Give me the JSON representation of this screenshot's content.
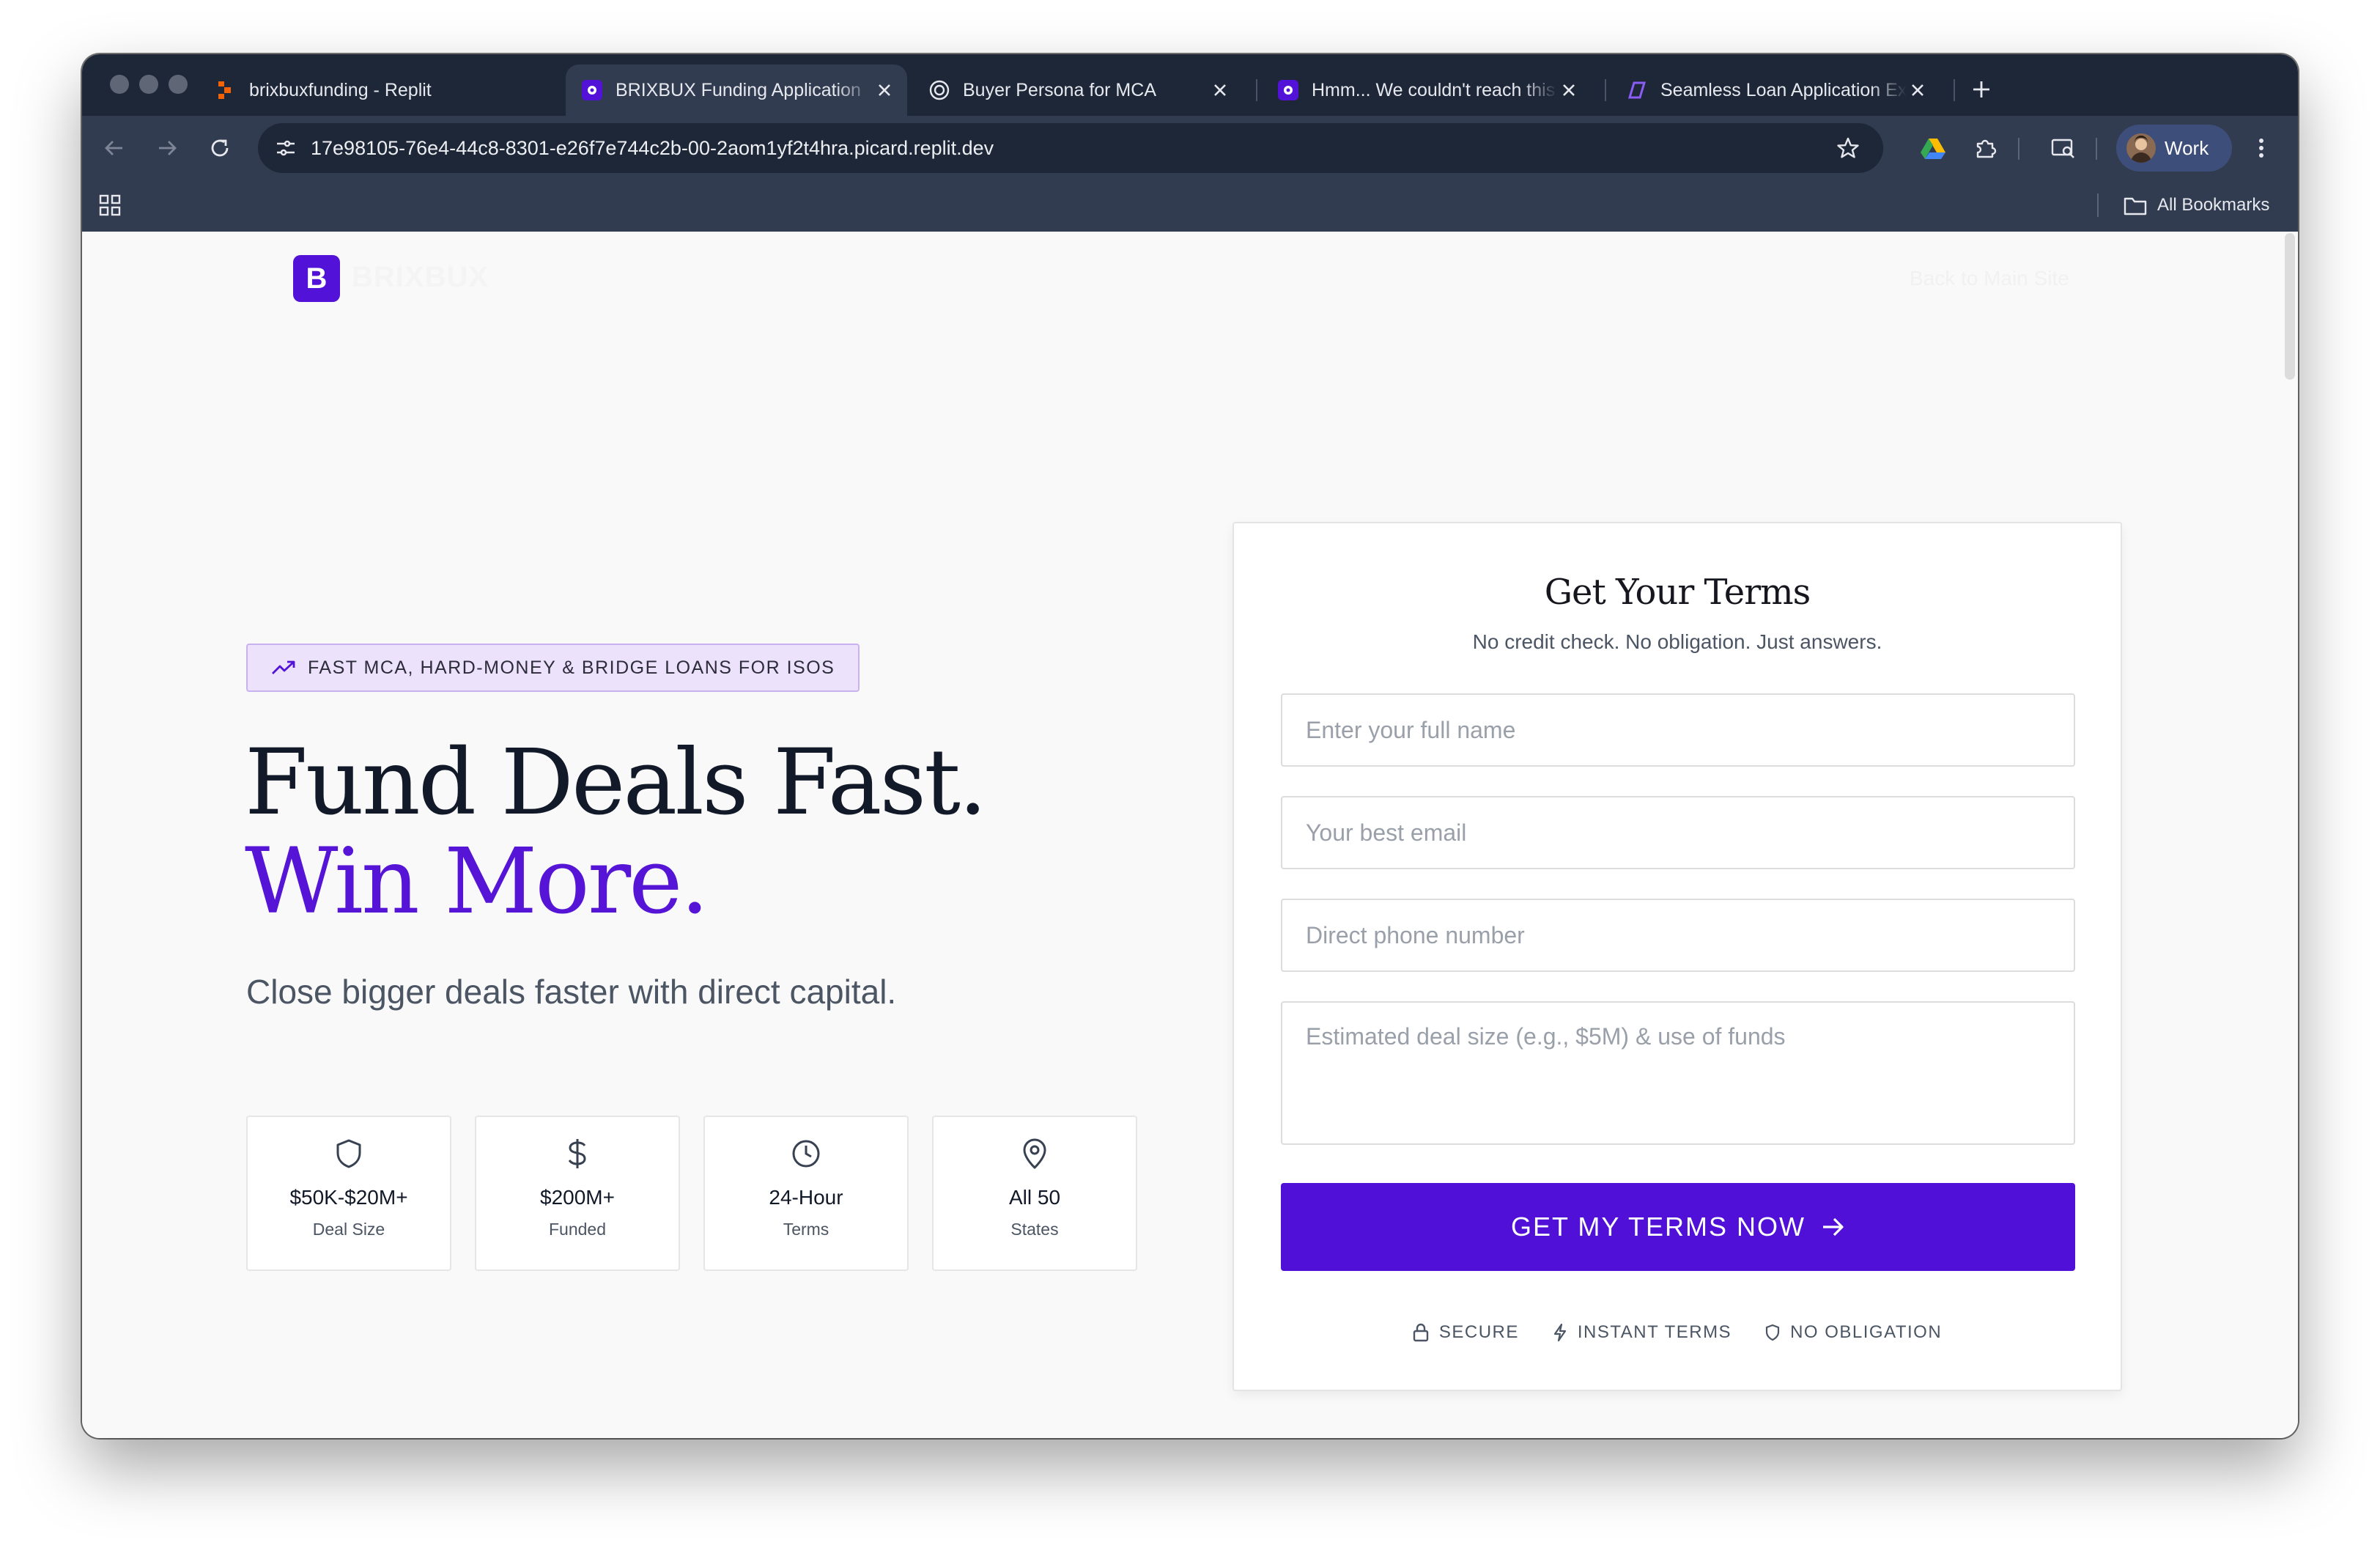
{
  "browser": {
    "tabs": [
      {
        "title": "brixbuxfunding - Replit",
        "favicon": "replit-icon",
        "active": false
      },
      {
        "title": "BRIXBUX Funding Application",
        "favicon": "brixbux-icon",
        "active": true
      },
      {
        "title": "Buyer Persona for MCA",
        "favicon": "openai-icon",
        "active": false
      },
      {
        "title": "Hmm... We couldn't reach this page",
        "favicon": "brixbux-icon",
        "active": false
      },
      {
        "title": "Seamless Loan Application Ex",
        "favicon": "app-icon",
        "active": false
      }
    ],
    "url": "17e98105-76e4-44c8-8301-e26f7e744c2b-00-2aom1yf2t4hra.picard.replit.dev",
    "profile_label": "Work",
    "bookmarks_label": "All Bookmarks"
  },
  "site": {
    "logo_letter": "B",
    "logo_text": "BRIXBUX",
    "back_link": "Back to Main Site"
  },
  "hero": {
    "eyebrow": "FAST MCA, HARD-MONEY & BRIDGE LOANS FOR ISOS",
    "headline_1": "Fund Deals Fast.",
    "headline_2": "Win More.",
    "subhead": "Close bigger deals faster with direct capital."
  },
  "stats": [
    {
      "icon": "shield-icon",
      "value": "$50K-$20M+",
      "label": "Deal Size"
    },
    {
      "icon": "dollar-icon",
      "value": "$200M+",
      "label": "Funded"
    },
    {
      "icon": "clock-icon",
      "value": "24-Hour",
      "label": "Terms"
    },
    {
      "icon": "map-pin-icon",
      "value": "All 50",
      "label": "States"
    }
  ],
  "form": {
    "title": "Get Your Terms",
    "subtitle": "No credit check. No obligation. Just answers.",
    "name_placeholder": "Enter your full name",
    "email_placeholder": "Your best email",
    "phone_placeholder": "Direct phone number",
    "deal_placeholder": "Estimated deal size (e.g., $5M) & use of funds",
    "submit_label": "GET MY TERMS NOW",
    "trust": [
      {
        "icon": "lock-icon",
        "label": "SECURE"
      },
      {
        "icon": "bolt-icon",
        "label": "INSTANT TERMS"
      },
      {
        "icon": "shield-icon",
        "label": "NO OBLIGATION"
      }
    ]
  },
  "colors": {
    "brand": "#5312d8",
    "eyebrow_bg": "#ece2fb",
    "browser_chrome": "#323c51",
    "tab_strip": "#1e2738"
  }
}
